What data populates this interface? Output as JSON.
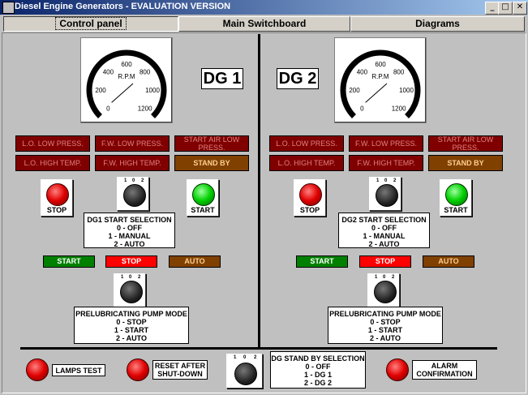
{
  "window": {
    "title": "Diesel Engine Generators   -  EVALUATION VERSION",
    "min": "_",
    "max": "□",
    "close": "✕"
  },
  "tabs": [
    {
      "label": "Control panel"
    },
    {
      "label": "Main Switchboard"
    },
    {
      "label": "Diagrams"
    }
  ],
  "gauge": {
    "unit": "R.P.M",
    "ticks": [
      "0",
      "200",
      "400",
      "600",
      "800",
      "1000",
      "1200"
    ]
  },
  "dg1": {
    "label": "DG 1",
    "alarms": [
      "L.O. LOW PRESS.",
      "F.W. LOW PRESS.",
      "START AIR LOW PRESS.",
      "L.O. HIGH TEMP.",
      "F.W. HIGH TEMP.",
      "STAND BY"
    ],
    "stop_label": "STOP",
    "start_label": "START",
    "selector_ticks": [
      "1",
      "0",
      "2"
    ],
    "start_selection": [
      "DG1 START SELECTION",
      "0 - OFF",
      "1 - MANUAL",
      "2 - AUTO"
    ],
    "buttons": [
      "START",
      "STOP",
      "AUTO"
    ],
    "pump_mode": [
      "PRELUBRICATING PUMP MODE",
      "0 - STOP",
      "1 - START",
      "2 - AUTO"
    ]
  },
  "dg2": {
    "label": "DG 2",
    "alarms": [
      "L.O. LOW PRESS.",
      "F.W. LOW PRESS.",
      "START AIR LOW PRESS.",
      "L.O. HIGH TEMP.",
      "F.W. HIGH TEMP.",
      "STAND BY"
    ],
    "stop_label": "STOP",
    "start_label": "START",
    "selector_ticks": [
      "1",
      "0",
      "2"
    ],
    "start_selection": [
      "DG2 START SELECTION",
      "0 - OFF",
      "1 - MANUAL",
      "2 - AUTO"
    ],
    "buttons": [
      "START",
      "STOP",
      "AUTO"
    ],
    "pump_mode": [
      "PRELUBRICATING PUMP MODE",
      "0 - STOP",
      "1 - START",
      "2 - AUTO"
    ]
  },
  "bottom": {
    "lamps_test": "LAMPS TEST",
    "reset": [
      "RESET AFTER",
      "SHUT-DOWN"
    ],
    "standby_ticks": [
      "1",
      "0",
      "2"
    ],
    "standby_selection": [
      "DG STAND BY SELECTION",
      "0 - OFF",
      "1 - DG 1",
      "2 - DG 2"
    ],
    "alarm_confirm": [
      "ALARM",
      "CONFIRMATION"
    ]
  },
  "colors": {
    "lamp_red": "#e00000",
    "lamp_green": "#00d000",
    "alarm_bg": "#800000",
    "standby_bg": "#804000"
  }
}
